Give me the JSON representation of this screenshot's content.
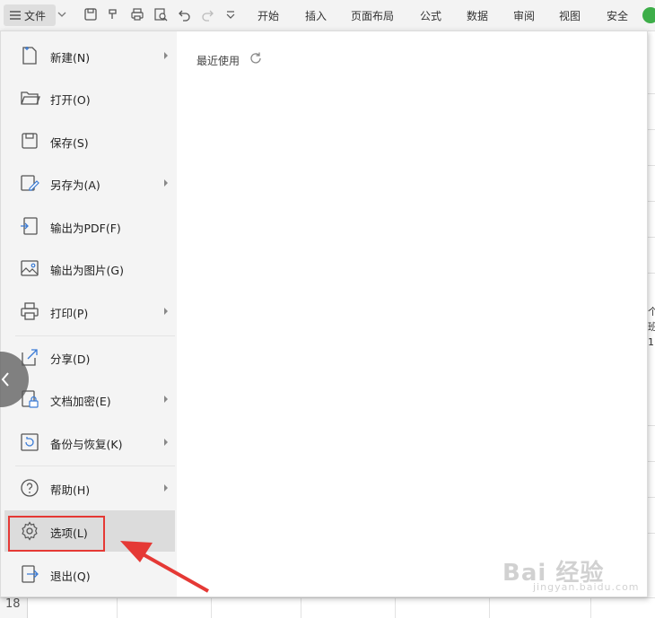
{
  "toolbar": {
    "file_label": "文件",
    "tabs": [
      "开始",
      "插入",
      "页面布局",
      "公式",
      "数据",
      "审阅",
      "视图",
      "安全"
    ]
  },
  "menu": {
    "recent_label": "最近使用",
    "items": [
      {
        "label": "新建(N)",
        "icon": "new-file-icon",
        "submenu": true
      },
      {
        "label": "打开(O)",
        "icon": "folder-open-icon",
        "submenu": false
      },
      {
        "label": "保存(S)",
        "icon": "save-icon",
        "submenu": false
      },
      {
        "label": "另存为(A)",
        "icon": "save-as-icon",
        "submenu": true
      },
      {
        "label": "输出为PDF(F)",
        "icon": "export-pdf-icon",
        "submenu": false
      },
      {
        "label": "输出为图片(G)",
        "icon": "export-image-icon",
        "submenu": false
      },
      {
        "label": "打印(P)",
        "icon": "print-icon",
        "submenu": true
      },
      {
        "label": "分享(D)",
        "icon": "share-icon",
        "submenu": false
      },
      {
        "label": "文档加密(E)",
        "icon": "encrypt-icon",
        "submenu": true
      },
      {
        "label": "备份与恢复(K)",
        "icon": "backup-icon",
        "submenu": true
      },
      {
        "label": "帮助(H)",
        "icon": "help-icon",
        "submenu": true
      },
      {
        "label": "选项(L)",
        "icon": "gear-icon",
        "submenu": false,
        "selected": true
      },
      {
        "label": "退出(Q)",
        "icon": "exit-icon",
        "submenu": false
      }
    ]
  },
  "sheet": {
    "row_number": "18",
    "cell_fragments": [
      "个",
      "班",
      "1"
    ]
  },
  "watermark": {
    "brand": "Bai 经验",
    "sub": "jingyan.baidu.com"
  },
  "colors": {
    "highlight": "#e53935",
    "status": "#3dae49",
    "menu_left_bg": "#f4f4f4"
  }
}
